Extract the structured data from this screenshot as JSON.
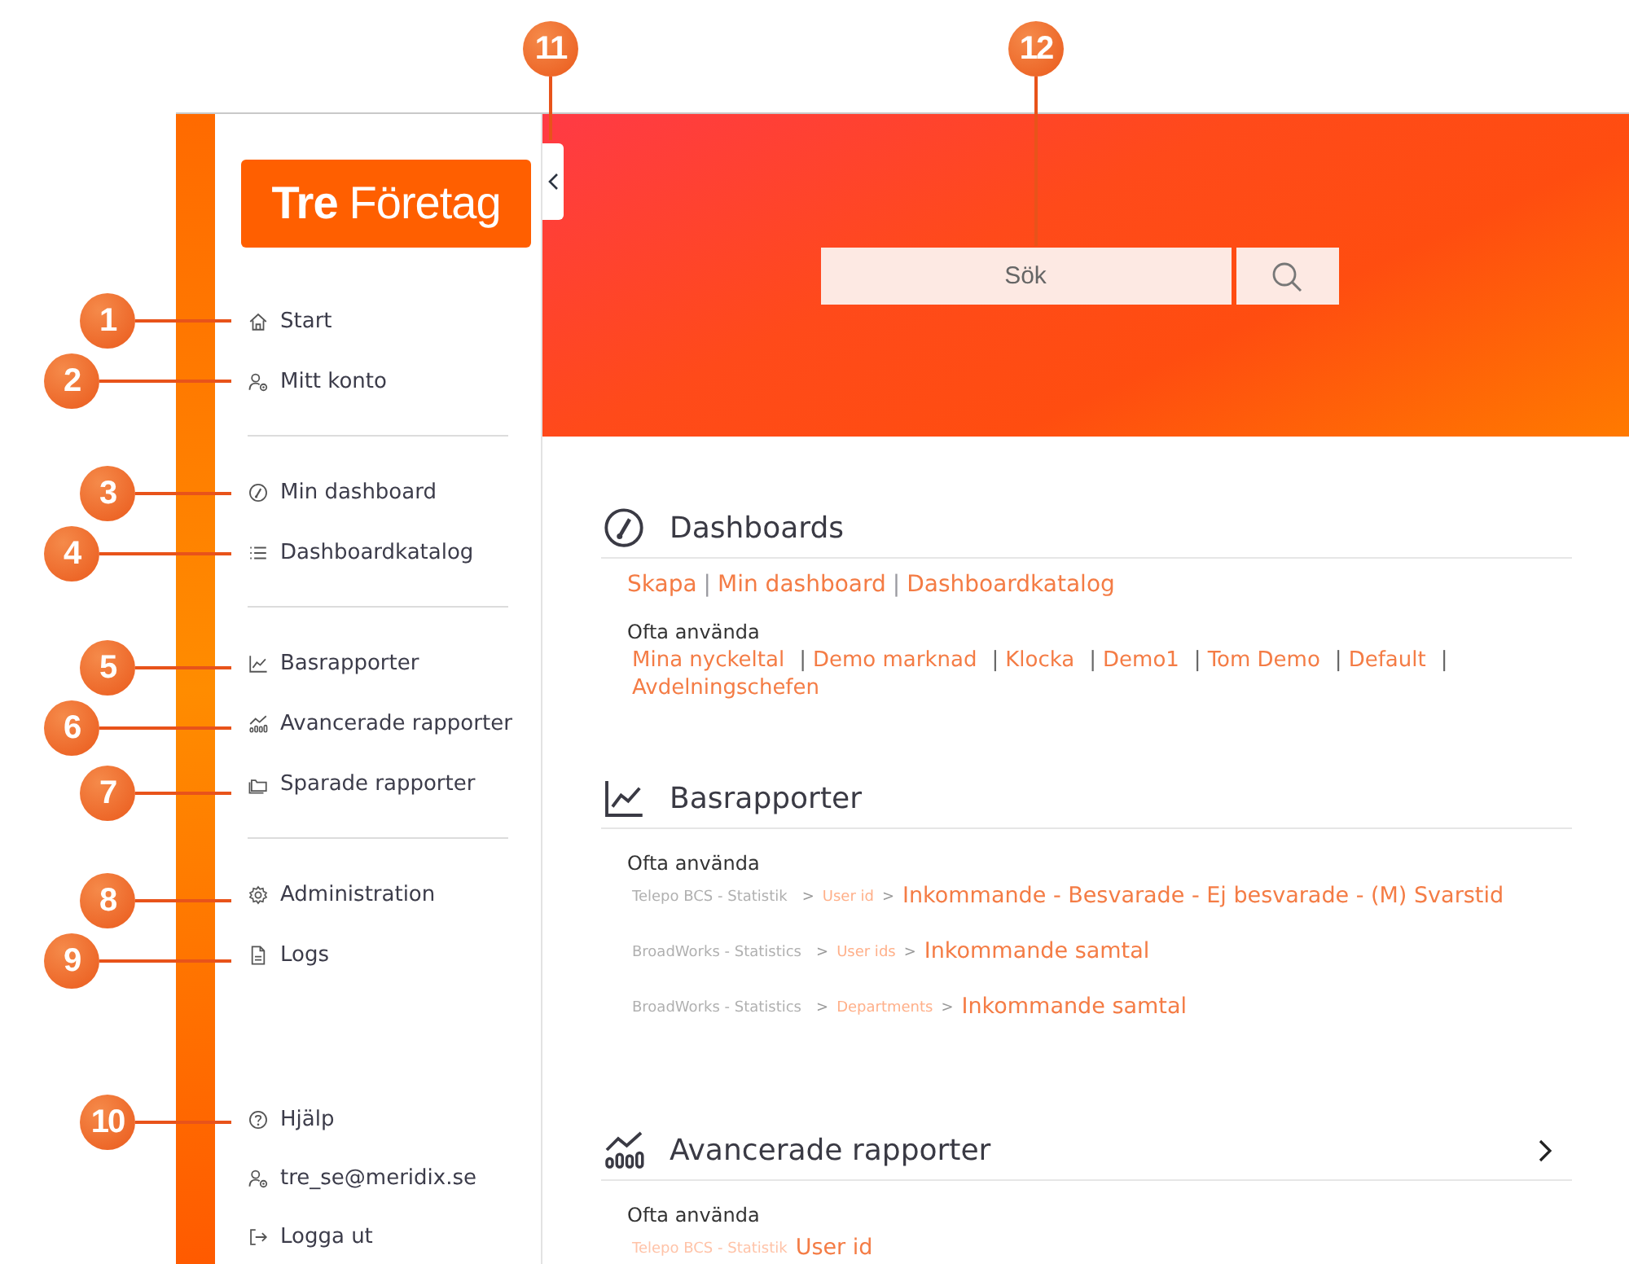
{
  "callouts": [
    "1",
    "2",
    "3",
    "4",
    "5",
    "6",
    "7",
    "8",
    "9",
    "10",
    "11",
    "12"
  ],
  "logo": {
    "bold": "Tre",
    "rest": "Företag"
  },
  "sidebar": {
    "groups": [
      [
        "Start",
        "Mitt konto"
      ],
      [
        "Min dashboard",
        "Dashboardkatalog"
      ],
      [
        "Basrapporter",
        "Avancerade rapporter",
        "Sparade rapporter"
      ],
      [
        "Administration",
        "Logs"
      ],
      [
        "Hjälp",
        "tre_se@meridix.se",
        "Logga ut"
      ]
    ]
  },
  "search": {
    "placeholder": "Sök"
  },
  "sections": [
    {
      "title": "Dashboards",
      "expandable": false,
      "links": [
        "Skapa",
        "Min dashboard",
        "Dashboardkatalog"
      ],
      "link_separator": "|",
      "frequent_label": "Ofta använda",
      "frequent": [
        "Mina nyckeltal",
        "Demo marknad",
        "Klocka",
        "Demo1",
        "Tom Demo",
        "Default",
        "Avdelningschefen"
      ]
    },
    {
      "title": "Basrapporter",
      "expandable": false,
      "frequent_label": "Ofta använda",
      "crumb_separator": ">",
      "reports": [
        {
          "source": "Telepo BCS - Statistik",
          "level": "User id",
          "name": "Inkommande - Besvarade - Ej besvarade - (M) Svarstid"
        },
        {
          "source": "BroadWorks - Statistics",
          "level": "User ids",
          "name": "Inkommande samtal"
        },
        {
          "source": "BroadWorks - Statistics",
          "level": "Departments",
          "name": "Inkommande samtal"
        }
      ]
    },
    {
      "title": "Avancerade rapporter",
      "expandable": true,
      "frequent_label": "Ofta använda",
      "reports": [
        {
          "source": "Telepo BCS - Statistik",
          "name": "User id"
        }
      ]
    }
  ]
}
